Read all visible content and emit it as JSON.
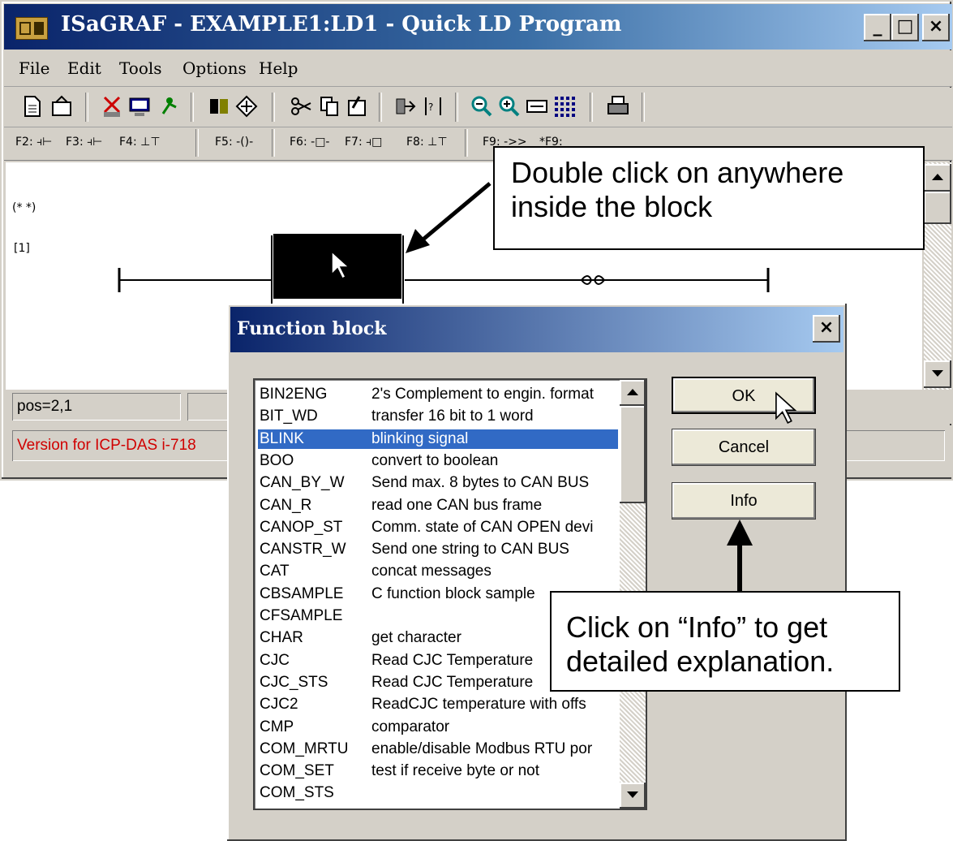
{
  "window": {
    "title": "ISaGRAF - EXAMPLE1:LD1 - Quick LD Program",
    "controls": {
      "minimize": "_",
      "maximize": "□",
      "close": "×"
    }
  },
  "menu": {
    "items": [
      {
        "label": "File"
      },
      {
        "label": "Edit"
      },
      {
        "label": "Tools"
      },
      {
        "label": "Options"
      },
      {
        "label": "Help"
      }
    ]
  },
  "fkeys": {
    "f2": "F2:",
    "f3": "F3:",
    "f4": "F4:",
    "f5": "F5:",
    "f6": "F6:",
    "f7": "F7:",
    "f8": "F8:",
    "f9": "F9:",
    "f9b": "*F9:"
  },
  "ladder": {
    "comment": "(* *)",
    "rung_number": "[1]"
  },
  "status": {
    "position": "pos=2,1",
    "version": "Version for ICP-DAS i-718"
  },
  "dialog": {
    "title": "Function block",
    "close": "×",
    "selected_index": 2,
    "items": [
      {
        "name": "BIN2ENG",
        "desc": "2's Complement to engin. format"
      },
      {
        "name": "BIT_WD",
        "desc": "transfer 16 bit to 1 word"
      },
      {
        "name": "BLINK",
        "desc": "blinking signal"
      },
      {
        "name": "BOO",
        "desc": "convert to boolean"
      },
      {
        "name": "CAN_BY_W",
        "desc": "Send max. 8 bytes to CAN BUS"
      },
      {
        "name": "CAN_R",
        "desc": "read one CAN bus frame"
      },
      {
        "name": "CANOP_ST",
        "desc": "Comm. state of CAN OPEN devi"
      },
      {
        "name": "CANSTR_W",
        "desc": "Send one string to CAN BUS"
      },
      {
        "name": "CAT",
        "desc": "concat messages"
      },
      {
        "name": "CBSAMPLE",
        "desc": "C function block sample"
      },
      {
        "name": "CFSAMPLE",
        "desc": ""
      },
      {
        "name": "CHAR",
        "desc": "get character"
      },
      {
        "name": "CJC",
        "desc": "Read CJC Temperature"
      },
      {
        "name": "CJC_STS",
        "desc": "Read CJC Temperature"
      },
      {
        "name": "CJC2",
        "desc": "ReadCJC temperature with offs"
      },
      {
        "name": "CMP",
        "desc": "comparator"
      },
      {
        "name": "COM_MRTU",
        "desc": "enable/disable Modbus RTU por"
      },
      {
        "name": "COM_SET",
        "desc": "test if receive byte or not"
      },
      {
        "name": "COM_STS",
        "desc": ""
      }
    ],
    "buttons": {
      "ok": "OK",
      "cancel": "Cancel",
      "info": "Info"
    }
  },
  "annotations": {
    "double_click_line1": "Double click on anywhere",
    "double_click_line2": "inside the block",
    "info_line1": "Click on “Info” to get",
    "info_line2": "detailed explanation."
  }
}
